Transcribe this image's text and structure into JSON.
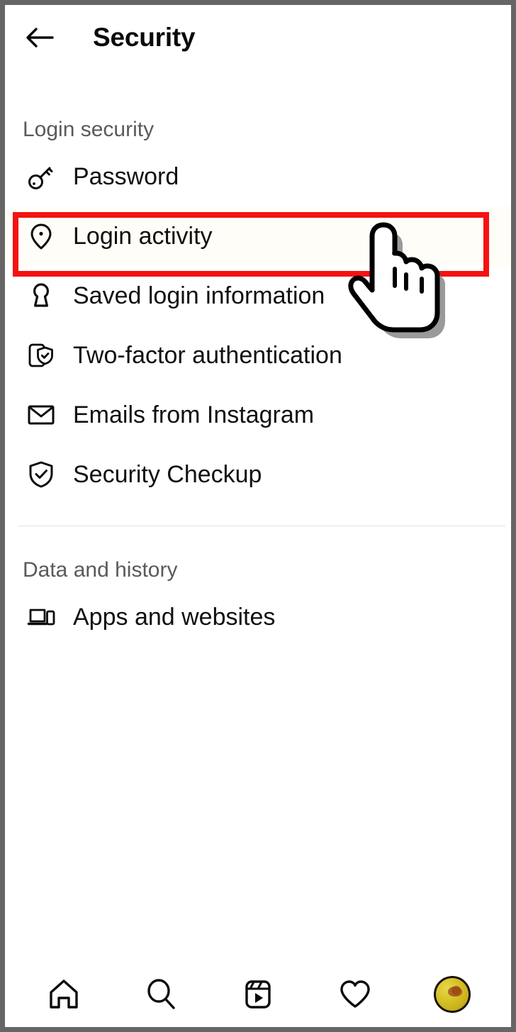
{
  "app": {
    "screen_title": "Security",
    "back_icon": "arrow-left-icon"
  },
  "sections": [
    {
      "title": "Login security",
      "items": [
        {
          "label": "Password",
          "icon": "key-icon"
        },
        {
          "label": "Login activity",
          "icon": "location-pin-icon",
          "highlighted": true
        },
        {
          "label": "Saved login information",
          "icon": "keyhole-icon"
        },
        {
          "label": "Two-factor authentication",
          "icon": "phone-shield-check-icon"
        },
        {
          "label": "Emails from Instagram",
          "icon": "envelope-icon"
        },
        {
          "label": "Security Checkup",
          "icon": "shield-check-icon"
        }
      ]
    },
    {
      "title": "Data and history",
      "items": [
        {
          "label": "Apps and websites",
          "icon": "laptop-phone-icon"
        }
      ]
    }
  ],
  "annotation": {
    "highlight_color": "#f41313",
    "cursor_icon": "pointing-hand-cursor"
  },
  "bottom_nav": {
    "items": [
      {
        "icon": "home-icon",
        "label": "Home"
      },
      {
        "icon": "search-icon",
        "label": "Search"
      },
      {
        "icon": "reels-icon",
        "label": "Reels"
      },
      {
        "icon": "heart-icon",
        "label": "Activity"
      },
      {
        "icon": "profile-avatar",
        "label": "Profile"
      }
    ]
  },
  "theme": {
    "background": "#ffffff",
    "text": "#101010",
    "section_text": "#5a5a5a",
    "frame_border": "#666666",
    "avatar_color": "#d4bf25"
  }
}
